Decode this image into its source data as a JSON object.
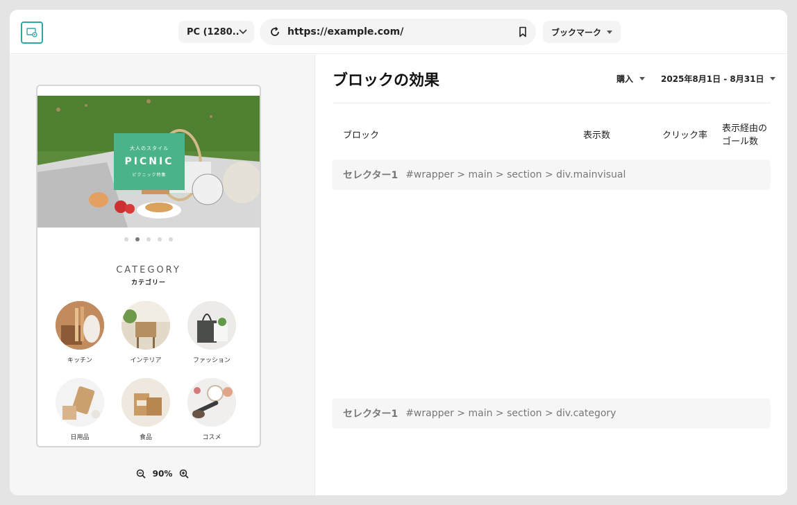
{
  "toolbar": {
    "device_label": "PC (1280...",
    "url": "https://example.com/",
    "bookmark_label": "ブックマーク"
  },
  "preview": {
    "hero": {
      "tagline": "大人のスタイル",
      "title": "PICNIC",
      "subtitle": "ピクニック特集"
    },
    "carousel": {
      "count": 5,
      "active": 2
    },
    "category_title": "CATEGORY",
    "category_subtitle": "カテゴリー",
    "categories": [
      {
        "label": "キッチン",
        "icon": "kitchen-image"
      },
      {
        "label": "インテリア",
        "icon": "interior-image"
      },
      {
        "label": "ファッション",
        "icon": "fashion-image"
      },
      {
        "label": "日用品",
        "icon": "daily-goods-image"
      },
      {
        "label": "食品",
        "icon": "food-image"
      },
      {
        "label": "コスメ",
        "icon": "cosmetics-image"
      }
    ],
    "zoom": "90%"
  },
  "report": {
    "title": "ブロックの効果",
    "event_filter": "購入",
    "date_range": "2025年8月1日 - 8月31日",
    "columns": {
      "block": "ブロック",
      "impressions": "表示数",
      "ctr": "クリック率",
      "goals_line1": "表示経由の",
      "goals_line2": "ゴール数"
    },
    "rows": [
      {
        "name": "セレクター1",
        "selector": "#wrapper > main > section  > div.mainvisual"
      },
      {
        "name": "セレクター1",
        "selector": "#wrapper > main > section  > div.category"
      }
    ]
  },
  "colors": {
    "accent": "#2aa9a4",
    "hero_card": "#4bb389"
  }
}
